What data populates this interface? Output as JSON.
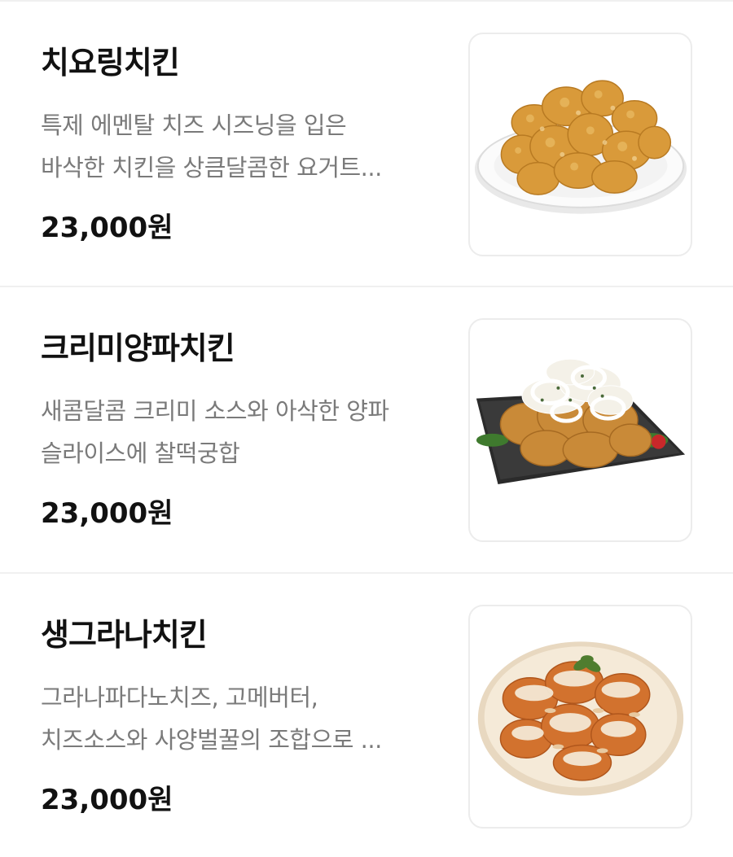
{
  "menu": {
    "items": [
      {
        "name": "치요링치킨",
        "desc_line1": "특제 에멘탈 치즈 시즈닝을 입은",
        "desc_line2": "바삭한 치킨을 상큼달콤한 요거트...",
        "price": "23,000원",
        "image": "fried-chicken-plate-image"
      },
      {
        "name": "크리미양파치킨",
        "desc_line1": "새콤달콤 크리미 소스와 아삭한 양파",
        "desc_line2": "슬라이스에 찰떡궁합",
        "price": "23,000원",
        "image": "onion-chicken-plate-image"
      },
      {
        "name": "생그라나치킨",
        "desc_line1": "그라나파다노치즈, 고메버터,",
        "desc_line2": "치즈소스와 사양벌꿀의 조합으로 ...",
        "price": "23,000원",
        "image": "grana-cheese-chicken-plate-image"
      }
    ]
  }
}
